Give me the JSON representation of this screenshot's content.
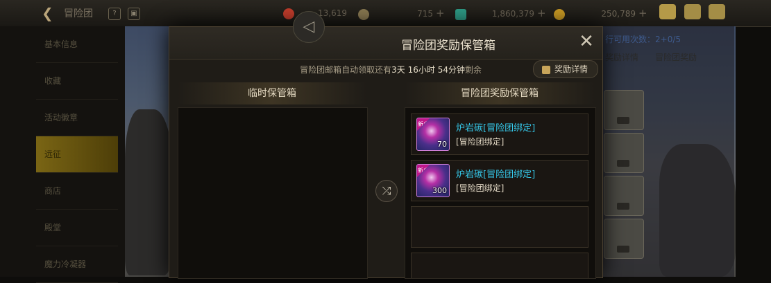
{
  "topbar": {
    "back_icon": "back-arrow-icon",
    "title": "冒险团",
    "currencies": [
      {
        "name": "trophy",
        "value": "13,619",
        "color": "#c33d2c"
      },
      {
        "name": "coin-c",
        "value": "715",
        "color": "#8a7a52"
      },
      {
        "name": "crystal",
        "value": "1,860,379",
        "color": "#2e9b86"
      },
      {
        "name": "gold",
        "value": "250,789",
        "color": "#c99a24"
      }
    ],
    "plus": "+"
  },
  "sidebar": {
    "items": [
      {
        "label": "基本信息"
      },
      {
        "label": "收藏"
      },
      {
        "label": "活动徽章"
      },
      {
        "label": "远征"
      },
      {
        "label": "商店"
      },
      {
        "label": "殿堂"
      },
      {
        "label": "魔力冷凝器"
      }
    ],
    "active_index": 3
  },
  "right_panel": {
    "top_text": "行可用次数：2+0/5",
    "btn1": "奖励详情",
    "btn2": "冒险团奖励"
  },
  "dialog": {
    "title": "冒险团奖励保管箱",
    "notice_prefix": "冒险团邮箱自动领取还有",
    "notice_time": "3天 16小时 54分钟",
    "notice_suffix": "剩余",
    "detail_button": "奖励详情",
    "temp_header": "临时保管箱",
    "reward_header": "冒险团奖励保管箱",
    "items": [
      {
        "name": "炉岩碳[冒险团绑定]",
        "sub": "[冒险团绑定]",
        "qty": "70",
        "tag": "新户"
      },
      {
        "name": "炉岩碳[冒险团绑定]",
        "sub": "[冒险团绑定]",
        "qty": "300",
        "tag": "新户"
      }
    ]
  }
}
